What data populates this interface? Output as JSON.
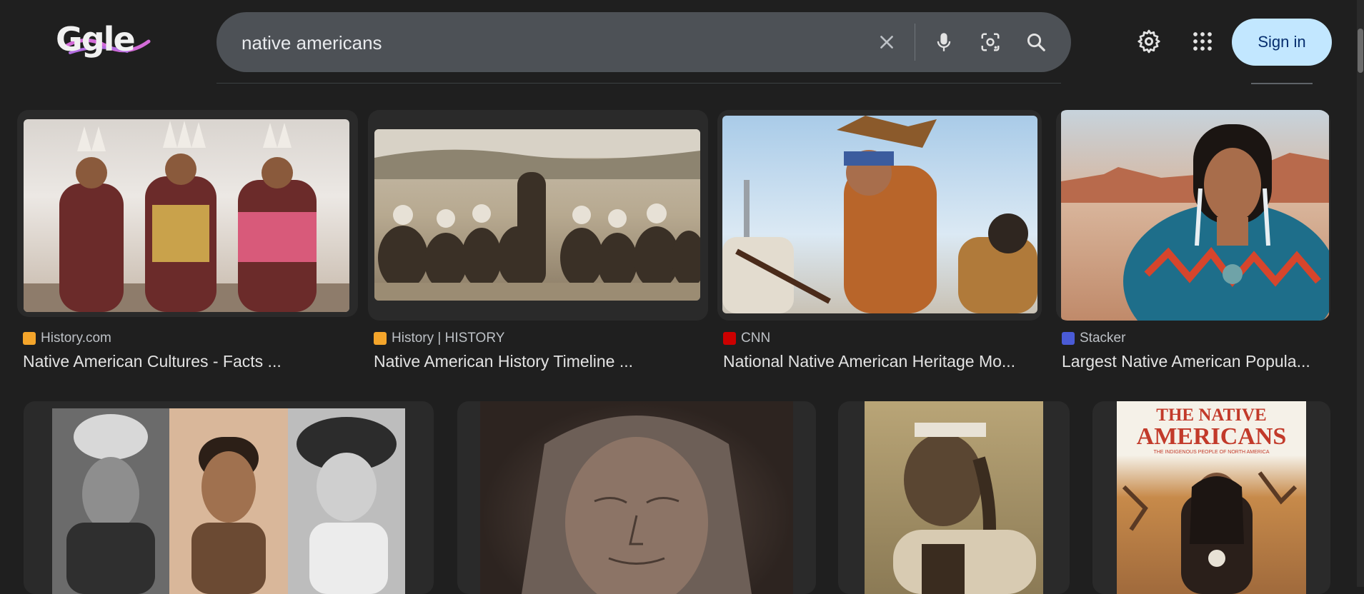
{
  "search": {
    "query": "native americans",
    "clear_icon": "close-icon",
    "voice_icon": "microphone-icon",
    "lens_icon": "camera-lens-icon",
    "search_icon": "search-icon"
  },
  "header": {
    "logo_text": "Ggle",
    "settings_icon": "gear-icon",
    "apps_icon": "apps-grid-icon",
    "sign_in_label": "Sign in"
  },
  "results": [
    {
      "source": "History.com",
      "title": "Native American Cultures - Facts ...",
      "favicon_color": "#f4a52b"
    },
    {
      "source": "History | HISTORY",
      "title": "Native American History Timeline ...",
      "favicon_color": "#f4a52b"
    },
    {
      "source": "CNN",
      "title": "National Native American Heritage Mo...",
      "favicon_color": "#cc0000"
    },
    {
      "source": "Stacker",
      "title": "Largest Native American Popula...",
      "favicon_color": "#4a5bd6"
    },
    {
      "source": "",
      "title": ""
    },
    {
      "source": "",
      "title": ""
    },
    {
      "source": "",
      "title": ""
    },
    {
      "source": "",
      "title": "",
      "cover_title_line1": "THE NATIVE",
      "cover_title_line2": "AMERICANS",
      "cover_subtitle": "THE INDIGENOUS PEOPLE OF NORTH AMERICA"
    }
  ],
  "colors": {
    "background": "#1f1f1f",
    "search_box": "#4d5156",
    "sign_in_bg": "#c2e7ff",
    "sign_in_text": "#062e6f"
  }
}
